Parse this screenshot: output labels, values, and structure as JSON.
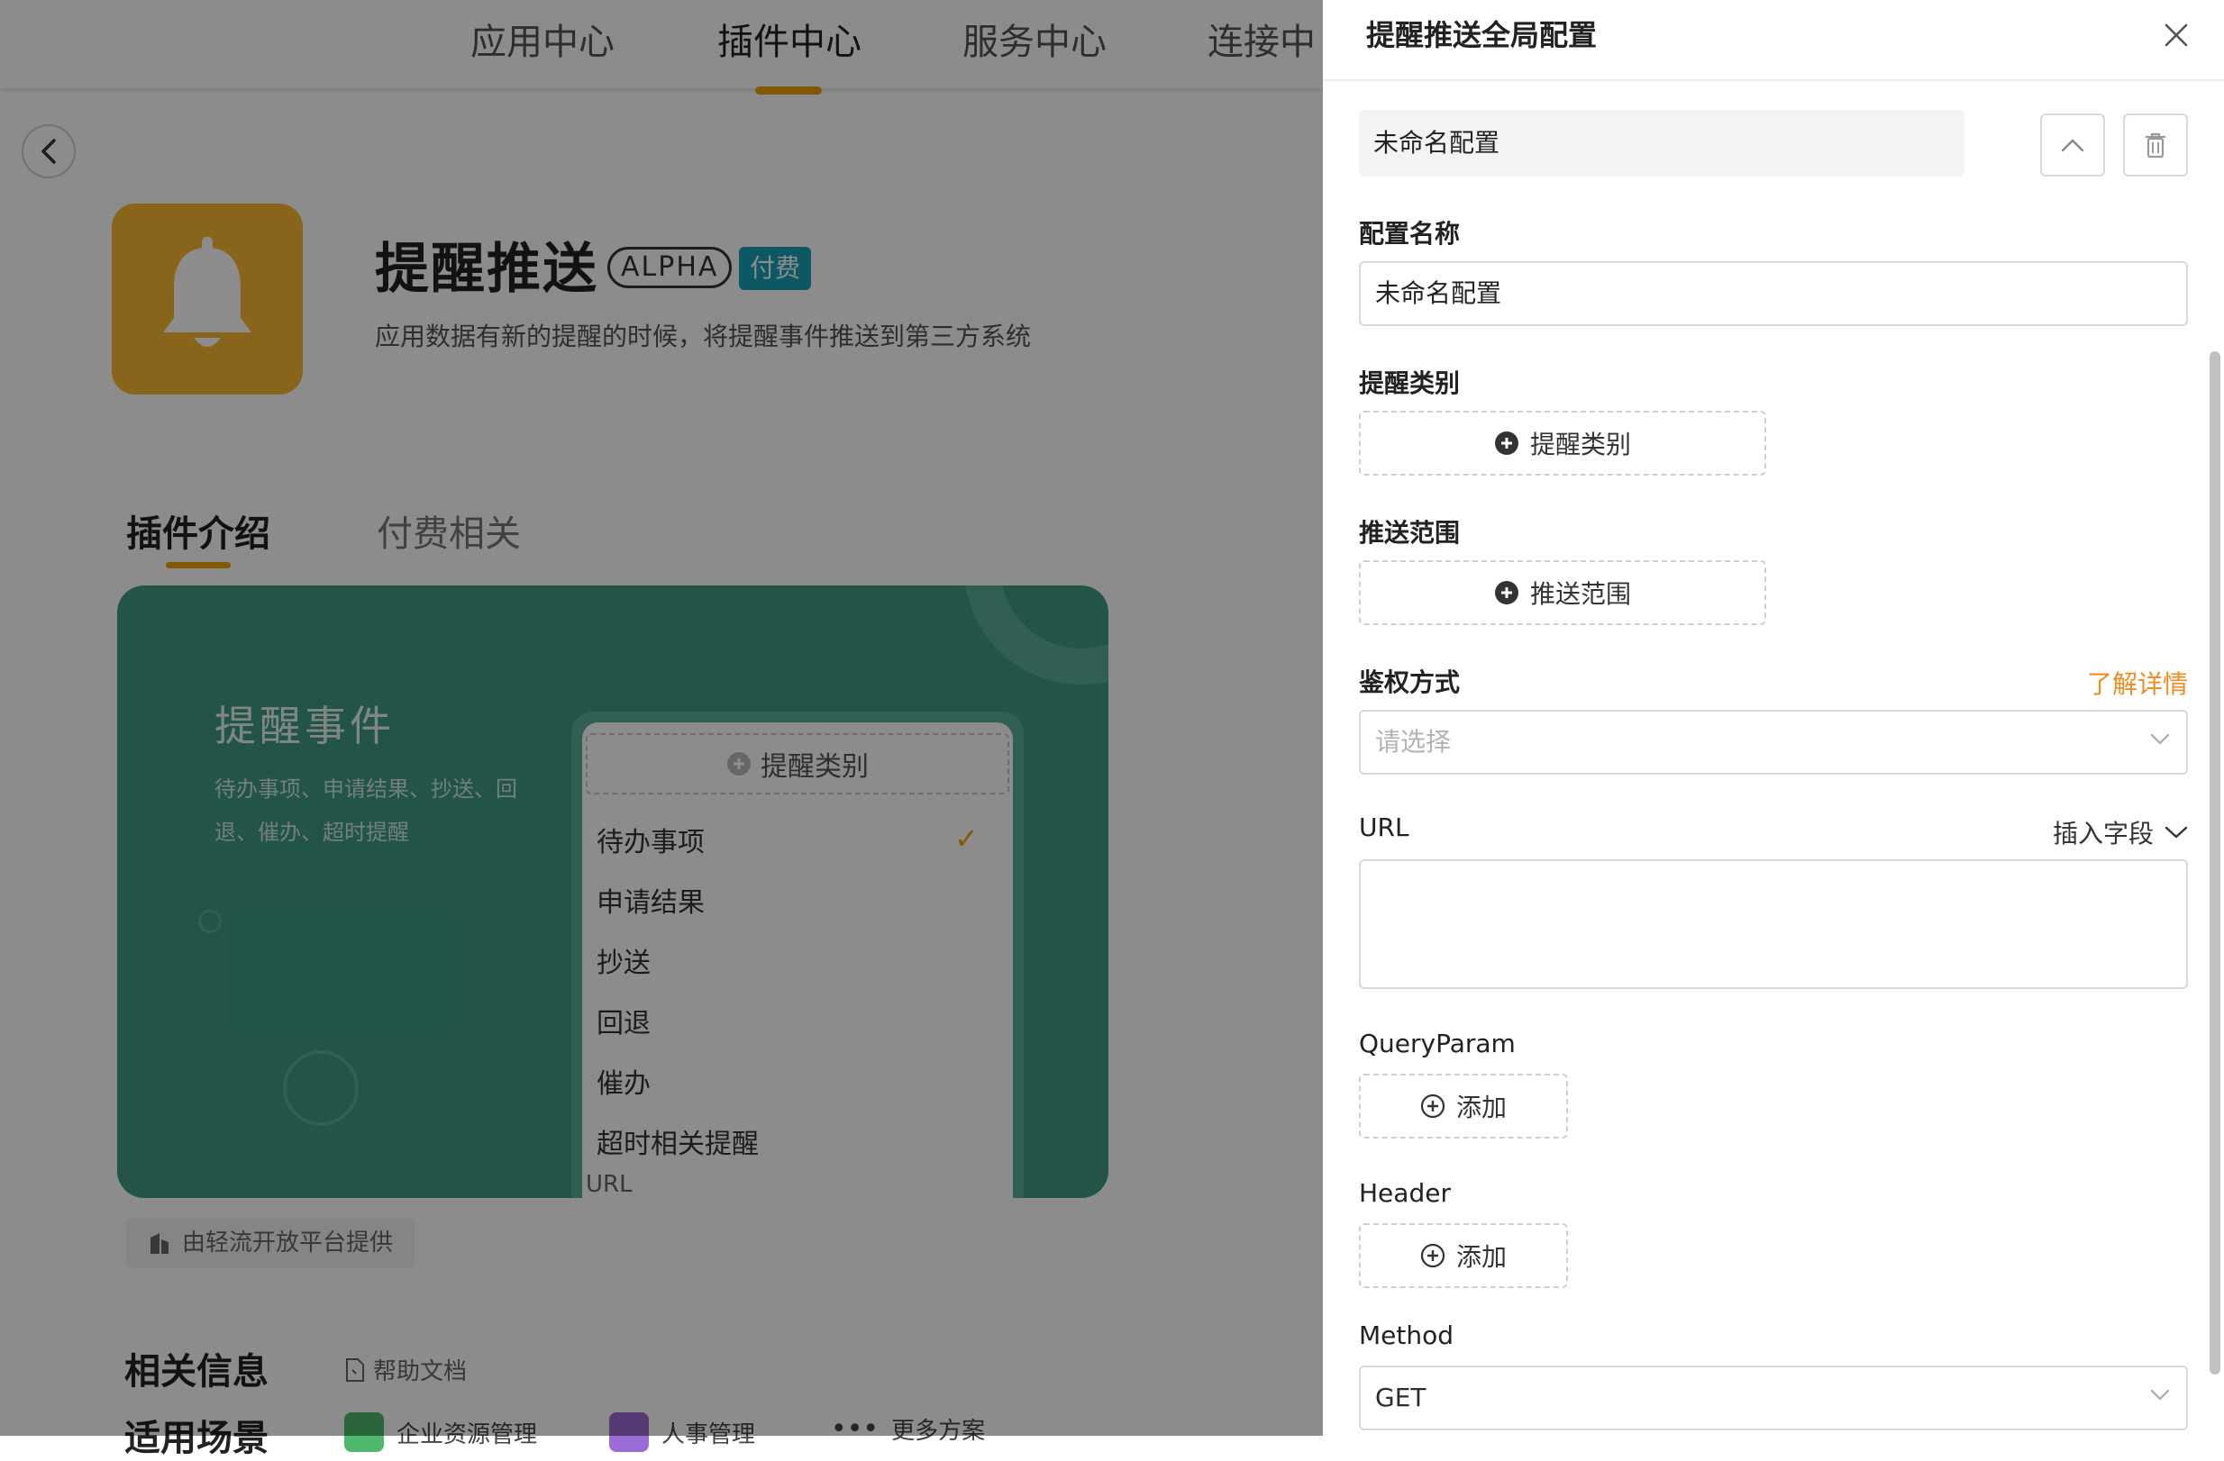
{
  "topnav": {
    "items": [
      {
        "label": "应用中心"
      },
      {
        "label": "插件中心"
      },
      {
        "label": "服务中心"
      },
      {
        "label": "连接中"
      }
    ]
  },
  "plugin": {
    "title": "提醒推送",
    "badge_alpha": "ALPHA",
    "badge_paid": "付费",
    "description": "应用数据有新的提醒的时候，将提醒事件推送到第三方系统",
    "tabs": [
      {
        "label": "插件介绍"
      },
      {
        "label": "付费相关"
      }
    ]
  },
  "banner": {
    "title": "提醒事件",
    "description": "待办事项、申请结果、抄送、回退、催办、超时提醒",
    "phone_add": "提醒类别",
    "phone_items": [
      "待办事项",
      "申请结果",
      "抄送",
      "回退",
      "催办",
      "超时相关提醒"
    ],
    "phone_cut": "URL"
  },
  "provider": "由轻流开放平台提供",
  "related": {
    "title": "相关信息",
    "help_link": "帮助文档",
    "scene_title": "适用场景",
    "scenes": [
      "企业资源管理",
      "人事管理",
      "更多方案"
    ]
  },
  "drawer": {
    "title": "提醒推送全局配置",
    "config_bar": "未命名配置",
    "config_name": {
      "label": "配置名称",
      "value": "未命名配置"
    },
    "remind_type": {
      "label": "提醒类别",
      "button": "提醒类别"
    },
    "push_scope": {
      "label": "推送范围",
      "button": "推送范围"
    },
    "auth": {
      "label": "鉴权方式",
      "link": "了解详情",
      "placeholder": "请选择"
    },
    "url": {
      "label": "URL",
      "insert_field": "插入字段"
    },
    "query_param": {
      "label": "QueryParam",
      "button": "添加"
    },
    "header": {
      "label": "Header",
      "button": "添加"
    },
    "method": {
      "label": "Method",
      "value": "GET"
    }
  },
  "colors": {
    "accent": "#f0a30a",
    "link": "#f08c1e",
    "banner": "#3e9c84",
    "paid": "#17a2b8"
  }
}
